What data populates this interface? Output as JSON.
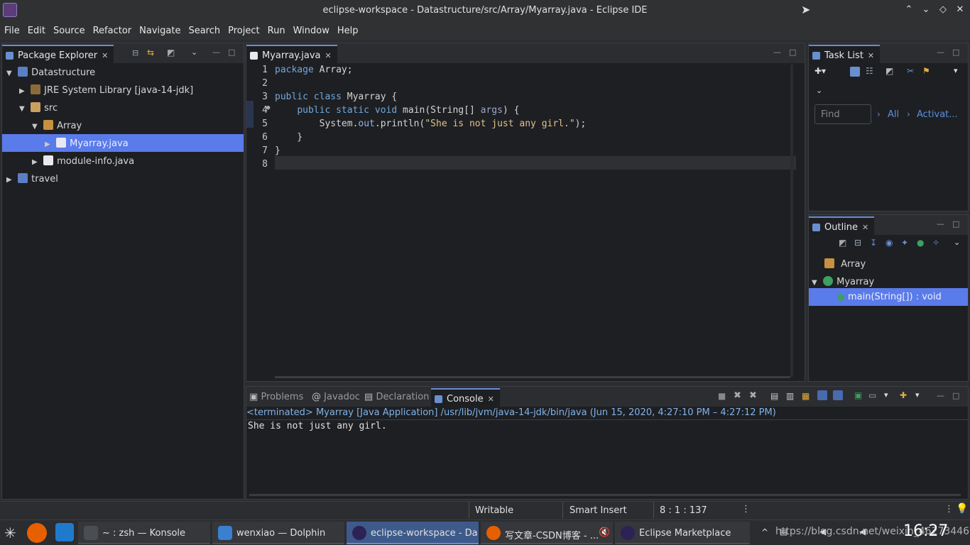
{
  "window": {
    "title": "eclipse-workspace - Datastructure/src/Array/Myarray.java - Eclipse IDE"
  },
  "menu": [
    "File",
    "Edit",
    "Source",
    "Refactor",
    "Navigate",
    "Search",
    "Project",
    "Run",
    "Window",
    "Help"
  ],
  "package_explorer": {
    "tab": "Package Explorer",
    "tree": [
      {
        "label": "Datastructure",
        "depth": 0,
        "expanded": true
      },
      {
        "label": "JRE System Library [java-14-jdk]",
        "depth": 1,
        "expanded": false
      },
      {
        "label": "src",
        "depth": 1,
        "expanded": true
      },
      {
        "label": "Array",
        "depth": 2,
        "expanded": true
      },
      {
        "label": "Myarray.java",
        "depth": 3,
        "expanded": false,
        "selected": true
      },
      {
        "label": "module-info.java",
        "depth": 2,
        "expanded": false
      },
      {
        "label": "travel",
        "depth": 0,
        "expanded": false
      }
    ]
  },
  "editor": {
    "tab": "Myarray.java",
    "lines": [
      {
        "n": "1",
        "code": "package Array;"
      },
      {
        "n": "2",
        "code": ""
      },
      {
        "n": "3",
        "code": "public class Myarray {"
      },
      {
        "n": "4",
        "code": "    public static void main(String[] args) {"
      },
      {
        "n": "5",
        "code": "        System.out.println(\"She is not just any girl.\");"
      },
      {
        "n": "6",
        "code": "    }"
      },
      {
        "n": "7",
        "code": "}"
      },
      {
        "n": "8",
        "code": ""
      }
    ]
  },
  "task_list": {
    "tab": "Task List",
    "find_placeholder": "Find",
    "all": "All",
    "activate": "Activat..."
  },
  "outline": {
    "tab": "Outline",
    "items": [
      {
        "label": "Array",
        "depth": 0
      },
      {
        "label": "Myarray",
        "depth": 0
      },
      {
        "label": "main(String[]) : void",
        "depth": 1,
        "selected": true
      }
    ]
  },
  "bottom_tabs": [
    "Problems",
    "Javadoc",
    "Declaration",
    "Console"
  ],
  "console": {
    "header": "<terminated> Myarray [Java Application] /usr/lib/jvm/java-14-jdk/bin/java  (Jun 15, 2020, 4:27:10 PM – 4:27:12 PM)",
    "output": "She is not just any girl."
  },
  "status": {
    "writable": "Writable",
    "insert_mode": "Smart Insert",
    "position": "8 : 1 : 137"
  },
  "taskbar": {
    "tasks": [
      {
        "label": "~ : zsh — Konsole",
        "color": "#4a4d52"
      },
      {
        "label": "wenxiao — Dolphin",
        "color": "#3a7fd0"
      },
      {
        "label": "eclipse-workspace - Da...",
        "color": "#2c2255",
        "active": true
      },
      {
        "label": "写文章-CSDN博客 - ...",
        "color": "#e66000"
      },
      {
        "label": "Eclipse Marketplace",
        "color": "#2c2255"
      }
    ],
    "clock": "16:27",
    "watermark": "https://blog.csdn.net/weixin_46273446"
  }
}
